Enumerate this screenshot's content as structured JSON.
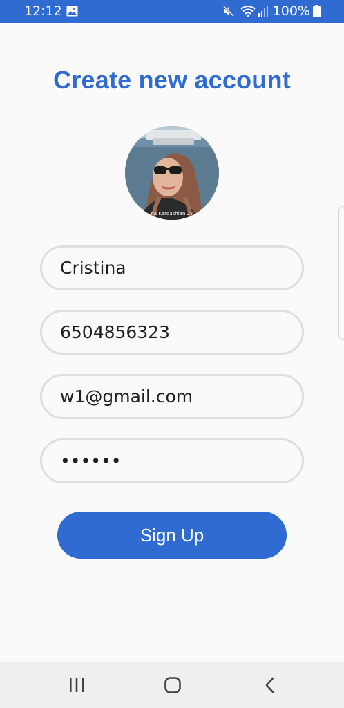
{
  "status_bar": {
    "time": "12:12",
    "battery_percent": "100%",
    "icons": [
      "image-icon",
      "mute-icon",
      "wifi-icon",
      "signal-icon",
      "battery-icon"
    ]
  },
  "title": "Create new account",
  "avatar": {
    "caption": "na Kardashian 27"
  },
  "form": {
    "name_value": "Cristina",
    "phone_value": "6504856323",
    "email_value": "w1@gmail.com",
    "password_value": "••••••"
  },
  "signup_button_label": "Sign Up",
  "nav_bar": {
    "icons": [
      "recents-icon",
      "home-icon",
      "back-icon"
    ]
  },
  "colors": {
    "primary": "#2f6bd0",
    "background": "#fafafa",
    "field_border": "#dedede",
    "nav_background": "#efefef"
  }
}
